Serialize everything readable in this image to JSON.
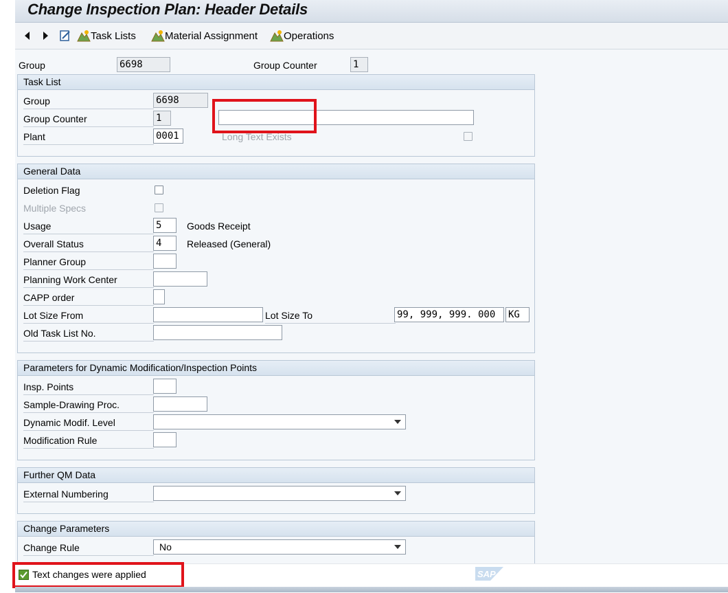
{
  "title": "Change Inspection Plan: Header Details",
  "toolbar": {
    "back_icon": "back-arrow-icon",
    "forward_icon": "forward-arrow-icon",
    "edit_icon": "edit-icon",
    "task_lists": "Task Lists",
    "material_assignment": "Material Assignment",
    "operations": "Operations"
  },
  "header": {
    "group_label": "Group",
    "group_value": "6698",
    "group_counter_label": "Group Counter",
    "group_counter_value": "1"
  },
  "task_list": {
    "title": "Task List",
    "group_label": "Group",
    "group_value": "6698",
    "group_counter_label": "Group Counter",
    "group_counter_value": "1",
    "description_value": "",
    "plant_label": "Plant",
    "plant_value": "0001",
    "long_text_label": "Long Text Exists",
    "long_text_checked": false
  },
  "general_data": {
    "title": "General Data",
    "deletion_flag_label": "Deletion Flag",
    "multiple_specs_label": "Multiple Specs",
    "usage_label": "Usage",
    "usage_value": "5",
    "usage_text": "Goods Receipt",
    "overall_status_label": "Overall Status",
    "overall_status_value": "4",
    "overall_status_text": "Released (General)",
    "planner_group_label": "Planner Group",
    "planner_group_value": "",
    "planning_work_center_label": "Planning Work Center",
    "planning_work_center_value": "",
    "capp_order_label": "CAPP order",
    "capp_order_value": "",
    "lot_size_from_label": "Lot Size From",
    "lot_size_from_value": "",
    "lot_size_to_label": "Lot Size To",
    "lot_size_to_value": "99, 999, 999. 000",
    "lot_size_unit": "KG",
    "old_task_list_label": "Old Task List No.",
    "old_task_list_value": ""
  },
  "dynamic_mod": {
    "title": "Parameters for Dynamic Modification/Inspection Points",
    "insp_points_label": "Insp. Points",
    "sample_drawing_label": "Sample-Drawing Proc.",
    "dynamic_modif_label": "Dynamic Modif. Level",
    "dynamic_modif_value": "",
    "modification_rule_label": "Modification Rule"
  },
  "further_qm": {
    "title": "Further QM Data",
    "external_numbering_label": "External Numbering",
    "external_numbering_value": ""
  },
  "change_params": {
    "title": "Change Parameters",
    "change_rule_label": "Change Rule",
    "change_rule_value": "No"
  },
  "status": {
    "message": "Text changes were applied",
    "icon": "success-check-icon"
  },
  "logo_text": "SAP"
}
